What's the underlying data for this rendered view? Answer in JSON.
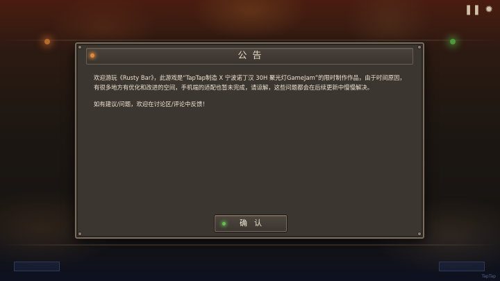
{
  "background": {
    "left_corner_button": "",
    "right_corner_button": "",
    "watermark": "TapTap"
  },
  "top_icons": [
    {
      "name": "pause-icon",
      "glyph": "❚❚"
    },
    {
      "name": "gear-icon",
      "glyph": "✹"
    }
  ],
  "dialog": {
    "title": "公告",
    "paragraphs": [
      "欢迎游玩《Rusty Bar》，此游戏是“TapTap制造 X 宁波诺丁汉 30H 聚光灯GameJam”的限时制作作品，由于时间原因，有很多地方有优化和改进的空间，手机端的适配也暂未完成，请谅解，这些问题都会在后续更新中慢慢解决。",
      "如有建议/问题，欢迎在讨论区/评论中反馈！"
    ],
    "confirm_label": "确认"
  },
  "colors": {
    "title_dot": "#e08a3a",
    "confirm_dot": "#62c54a",
    "panel": "#3c3630",
    "text": "#ece2d2"
  }
}
